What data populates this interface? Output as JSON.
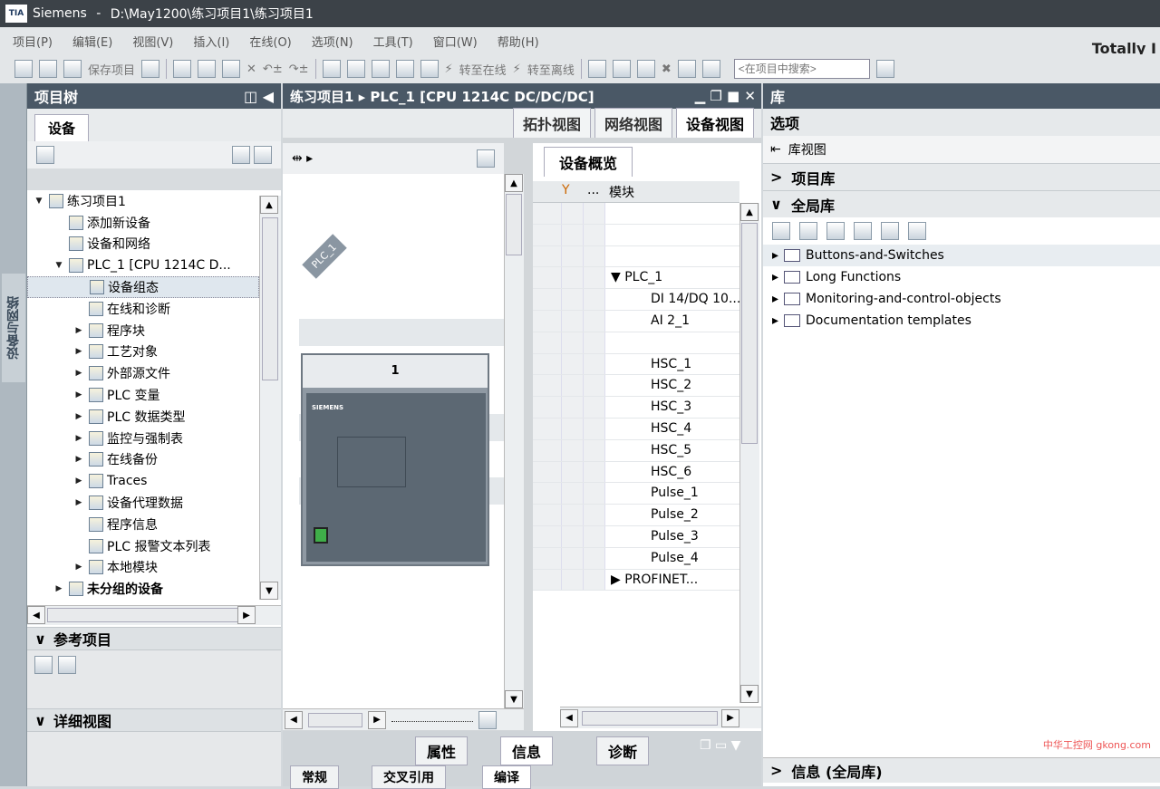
{
  "titlebar": {
    "app": "Siemens",
    "path": "D:\\May1200\\练习项目1\\练习项目1",
    "logo": "TIA"
  },
  "menu": [
    "项目(P)",
    "编辑(E)",
    "视图(V)",
    "插入(I)",
    "在线(O)",
    "选项(N)",
    "工具(T)",
    "窗口(W)",
    "帮助(H)"
  ],
  "brand": "Totally I",
  "toolbar": {
    "save": "保存项目",
    "go_online": "转至在线",
    "go_offline": "转至离线",
    "search_placeholder": "<在项目中搜索>"
  },
  "left_vertical_tab": "设备与网络",
  "project_tree": {
    "title": "项目树",
    "tab": "设备",
    "items": [
      {
        "label": "练习项目1",
        "indent": 0,
        "arrow": "▼"
      },
      {
        "label": "添加新设备",
        "indent": 1,
        "arrow": ""
      },
      {
        "label": "设备和网络",
        "indent": 1,
        "arrow": ""
      },
      {
        "label": "PLC_1 [CPU 1214C D...",
        "indent": 1,
        "arrow": "▼"
      },
      {
        "label": "设备组态",
        "indent": 2,
        "arrow": "",
        "selected": true
      },
      {
        "label": "在线和诊断",
        "indent": 2,
        "arrow": ""
      },
      {
        "label": "程序块",
        "indent": 2,
        "arrow": "▶"
      },
      {
        "label": "工艺对象",
        "indent": 2,
        "arrow": "▶"
      },
      {
        "label": "外部源文件",
        "indent": 2,
        "arrow": "▶"
      },
      {
        "label": "PLC 变量",
        "indent": 2,
        "arrow": "▶"
      },
      {
        "label": "PLC 数据类型",
        "indent": 2,
        "arrow": "▶"
      },
      {
        "label": "监控与强制表",
        "indent": 2,
        "arrow": "▶"
      },
      {
        "label": "在线备份",
        "indent": 2,
        "arrow": "▶"
      },
      {
        "label": "Traces",
        "indent": 2,
        "arrow": "▶"
      },
      {
        "label": "设备代理数据",
        "indent": 2,
        "arrow": "▶"
      },
      {
        "label": "程序信息",
        "indent": 2,
        "arrow": ""
      },
      {
        "label": "PLC 报警文本列表",
        "indent": 2,
        "arrow": ""
      },
      {
        "label": "本地模块",
        "indent": 2,
        "arrow": "▶"
      },
      {
        "label": "未分组的设备",
        "indent": 1,
        "arrow": "▶",
        "bold": true
      }
    ]
  },
  "reference_projects": "参考项目",
  "detail_view": "详细视图",
  "editor": {
    "title": "练习项目1 ▸ PLC_1 [CPU 1214C DC/DC/DC]",
    "tabs": [
      "拓扑视图",
      "网络视图",
      "设备视图"
    ],
    "plc_label": "PLC_1",
    "rack_slot": "1",
    "cpu_brand": "SIEMENS"
  },
  "device_overview": {
    "tab": "设备概览",
    "column": "模块",
    "rows": [
      "",
      "",
      "",
      "▼ PLC_1",
      "DI 14/DQ 10...",
      "AI 2_1",
      "",
      "HSC_1",
      "HSC_2",
      "HSC_3",
      "HSC_4",
      "HSC_5",
      "HSC_6",
      "Pulse_1",
      "Pulse_2",
      "Pulse_3",
      "Pulse_4",
      "▶ PROFINET..."
    ]
  },
  "inspector": {
    "tabs": [
      "属性",
      "信息",
      "诊断"
    ],
    "subtabs": [
      "常规",
      "交叉引用",
      "编译"
    ]
  },
  "library": {
    "title": "库",
    "options": "选项",
    "view": "库视图",
    "project_lib": "项目库",
    "global_lib": "全局库",
    "items": [
      "Buttons-and-Switches",
      "Long Functions",
      "Monitoring-and-control-objects",
      "Documentation templates"
    ],
    "info": "信息 (全局库)"
  },
  "watermark": "中华工控网 gkong.com"
}
